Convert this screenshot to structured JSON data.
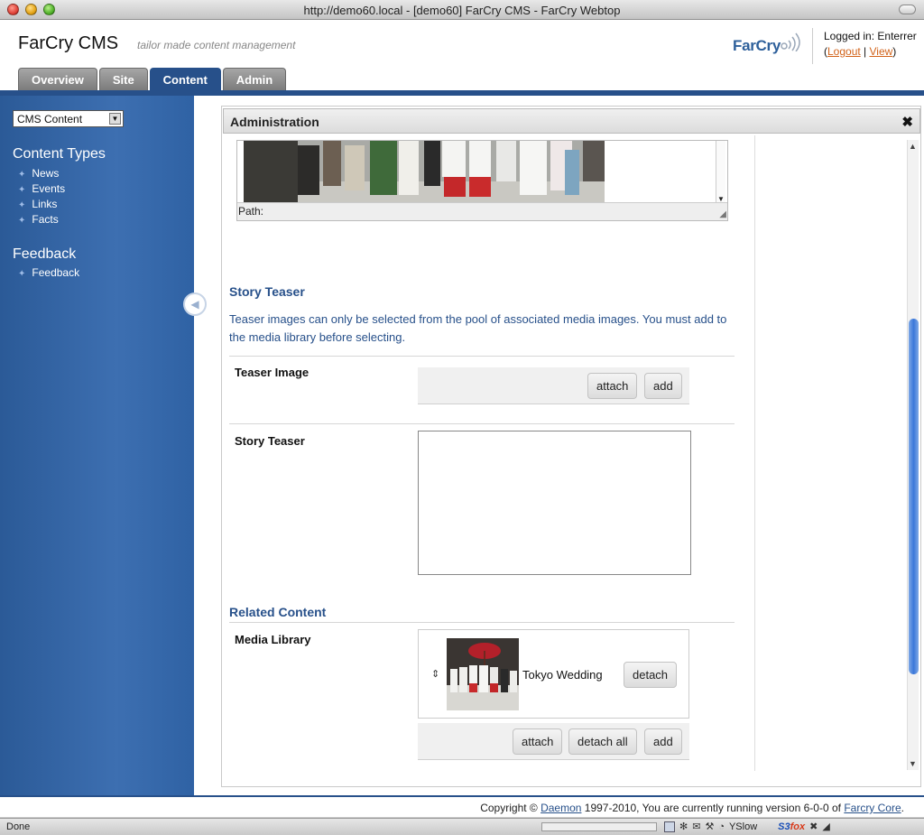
{
  "window": {
    "title": "http://demo60.local - [demo60] FarCry CMS - FarCry Webtop"
  },
  "header": {
    "brand": "FarCry CMS",
    "tagline": "tailor made content management",
    "logo_text": "FarCry",
    "logged_in": "Logged in: Enterrer",
    "paren_open": "(",
    "separator": " | ",
    "paren_close": ")",
    "logout": "Logout",
    "view": "View"
  },
  "tabs": [
    {
      "label": "Overview",
      "active": false
    },
    {
      "label": "Site",
      "active": false
    },
    {
      "label": "Content",
      "active": true
    },
    {
      "label": "Admin",
      "active": false
    }
  ],
  "sidebar": {
    "select_value": "CMS Content",
    "groups": [
      {
        "title": "Content Types",
        "items": [
          "News",
          "Events",
          "Links",
          "Facts"
        ]
      },
      {
        "title": "Feedback",
        "items": [
          "Feedback"
        ]
      }
    ]
  },
  "panel": {
    "title": "Administration",
    "path_label": "Path:",
    "story_teaser_heading": "Story Teaser",
    "help_text": "Teaser images can only be selected from the pool of associated media images. You must add to the media library before selecting.",
    "teaser_image_label": "Teaser Image",
    "teaser_buttons": {
      "attach": "attach",
      "add": "add"
    },
    "story_teaser_label": "Story Teaser",
    "story_teaser_value": "",
    "related_heading": "Related Content",
    "media_library_label": "Media Library",
    "media_item": {
      "title": "Tokyo Wedding",
      "detach": "detach"
    },
    "media_buttons": {
      "attach": "attach",
      "detach_all": "detach all",
      "add": "add"
    }
  },
  "footer": {
    "copyright_prefix": "Copyright © ",
    "daemon": "Daemon",
    "middle": " 1997-2010, You are currently running version 6-0-0 of ",
    "farcry_core": "Farcry Core",
    "suffix": "."
  },
  "status": {
    "text": "Done",
    "yslow": "YSlow",
    "s3": "S3",
    "fox": "fox"
  },
  "colors": {
    "accent": "#27508a",
    "sidebar": "#3d6fb1",
    "link_orange": "#d2631a"
  }
}
